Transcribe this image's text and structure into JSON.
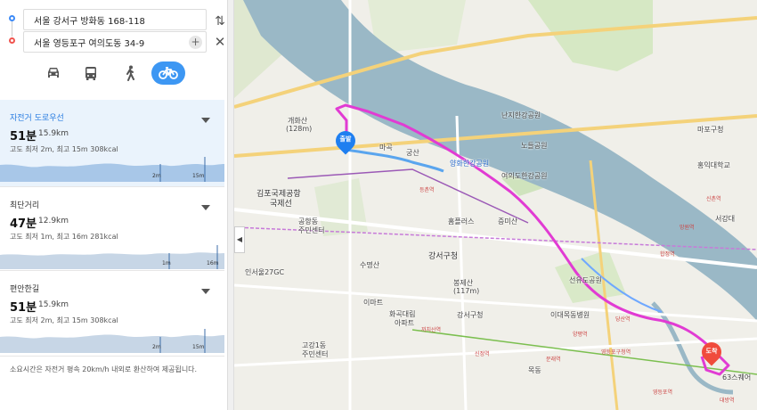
{
  "search": {
    "start_address": "서울 강서구 방화동 168-118",
    "end_address": "서울 영등포구 여의도동 34-9",
    "add_label": "+",
    "swap_label": "⇅",
    "close_label": "✕"
  },
  "modes": {
    "car_icon": "car-icon",
    "bus_icon": "bus-icon",
    "walk_icon": "walk-icon",
    "bike_icon": "bicycle-icon",
    "active": "bike",
    "active_color": "#3d97f3"
  },
  "routes": [
    {
      "name": "자전거 도로우선",
      "time": "51분",
      "distance": "15.9km",
      "info": "고도 최저 2m, 최고 15m    308kcal",
      "graph_low": "2m",
      "graph_high": "15m",
      "selected": true
    },
    {
      "name": "최단거리",
      "time": "47분",
      "distance": "12.9km",
      "info": "고도 최저 1m, 최고 16m    281kcal",
      "graph_low": "1m",
      "graph_high": "16m",
      "selected": false
    },
    {
      "name": "편안한길",
      "time": "51분",
      "distance": "15.9km",
      "info": "고도 최저 2m, 최고 15m    308kcal",
      "graph_low": "2m",
      "graph_high": "15m",
      "selected": false
    }
  ],
  "note": "소요시간은 자전거 평속 20km/h 내외로 환산하여 제공됩니다.",
  "collapse_label": "◀",
  "map": {
    "start_pin": "출발",
    "end_pin": "도착",
    "route_color": "#e13bd3",
    "river_color": "#9ab8c6",
    "labels": [
      "개화산",
      "(128m)",
      "마곡",
      "궁산",
      "강서구청",
      "등촌역",
      "홈플러스",
      "증미산",
      "수명산",
      "이마트",
      "화곡대림",
      "아파트",
      "여의도한강공원",
      "노들공원",
      "선유도공원",
      "당산역",
      "영등포구청역",
      "강서구청",
      "봉제산",
      "(117m)",
      "양화한강공원",
      "난지한강공원",
      "합정역",
      "망원역",
      "신촌역",
      "서강대",
      "영등포역",
      "63스퀘어",
      "김포국제공항",
      "국제선",
      "공항동",
      "주민센터",
      "인서울27GC",
      "고강1동",
      "주민센터",
      "마포구청",
      "홍익대학교",
      "이대목동병원",
      "목동",
      "신정역",
      "양평역",
      "문래역",
      "까치산역",
      "대방역"
    ]
  }
}
